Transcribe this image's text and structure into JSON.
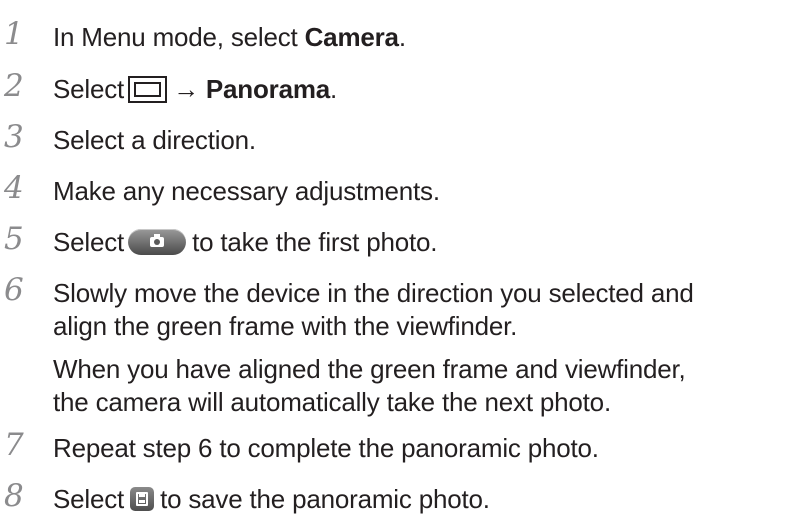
{
  "steps": [
    {
      "num": "1",
      "before": "In Menu mode, select ",
      "bold": "Camera",
      "after": "."
    },
    {
      "num": "2",
      "before": "Select",
      "arrow": "→ ",
      "bold": "Panorama",
      "after": ".",
      "icon": "frame-mode-icon"
    },
    {
      "num": "3",
      "text": "Select a direction."
    },
    {
      "num": "4",
      "text": "Make any necessary adjustments."
    },
    {
      "num": "5",
      "before": "Select",
      "after": "to take the first photo.",
      "icon": "camera-shutter-icon"
    },
    {
      "num": "6",
      "lines": [
        "Slowly move the device in the direction you selected and",
        "align the green frame with the viewfinder.",
        "When you have aligned the green frame and viewfinder,",
        "the camera will automatically take the next photo."
      ]
    },
    {
      "num": "7",
      "text": "Repeat step 6 to complete the panoramic photo."
    },
    {
      "num": "8",
      "before": "Select",
      "after": "to save the panoramic photo.",
      "icon": "save-icon"
    }
  ],
  "colors": {
    "text": "#231f20",
    "step_number": "#8b8b8d",
    "shutter_button": "#6e6e6e"
  }
}
